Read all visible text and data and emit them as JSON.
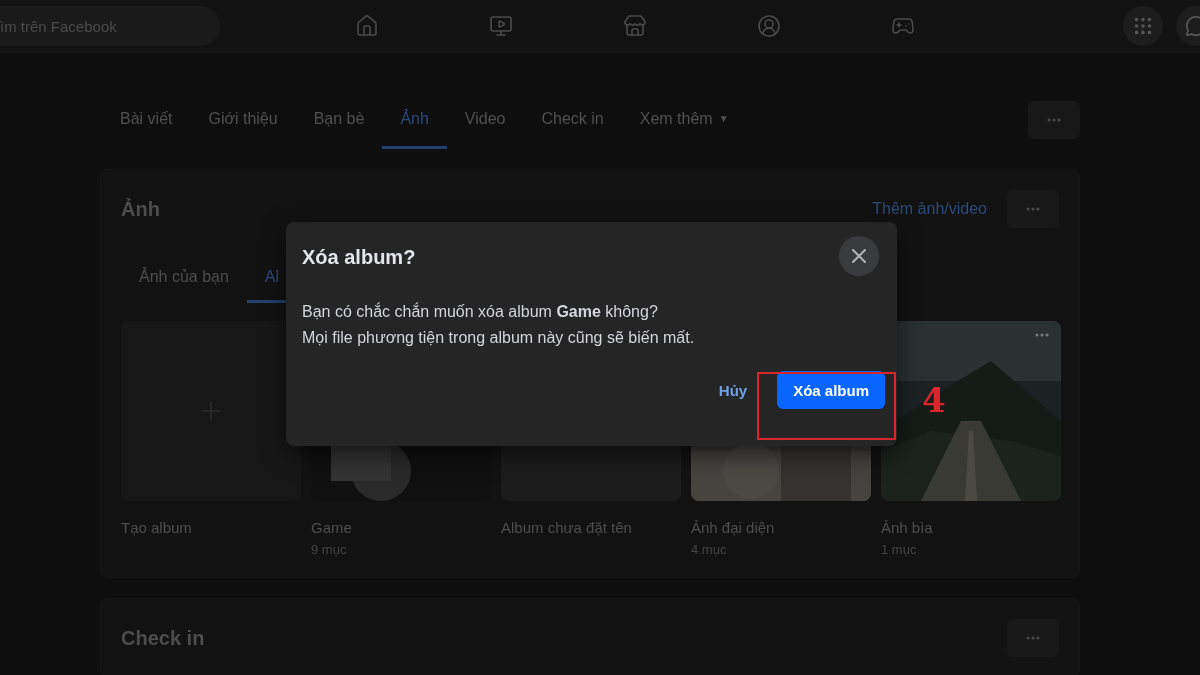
{
  "top_nav": {
    "search": {
      "placeholder": "ìm trên Facebook"
    }
  },
  "profile_tabs": [
    {
      "label": "Bài viết",
      "selected": false
    },
    {
      "label": "Giới thiệu",
      "selected": false
    },
    {
      "label": "Bạn bè",
      "selected": false
    },
    {
      "label": "Ảnh",
      "selected": true
    },
    {
      "label": "Video",
      "selected": false
    },
    {
      "label": "Check in",
      "selected": false
    },
    {
      "label": "Xem thêm",
      "selected": false,
      "caret": "▼"
    }
  ],
  "photos_section": {
    "title": "Ảnh",
    "add_link": "Thêm ảnh/video",
    "sub_tabs": [
      {
        "label": "Ảnh của bạn",
        "selected": false
      },
      {
        "label": "Al",
        "selected": true
      }
    ],
    "albums": [
      {
        "kind": "create",
        "name": "Tạo album"
      },
      {
        "name": "Game",
        "count": "9 mục"
      },
      {
        "kind": "blank",
        "name": "Album chưa đặt tên"
      },
      {
        "name": "Ảnh đại diện",
        "count": "4 mục"
      },
      {
        "name": "Ảnh bìa",
        "count": "1 mục"
      }
    ]
  },
  "checkin_section": {
    "title": "Check in"
  },
  "dialog": {
    "title": "Xóa album?",
    "message": [
      "Bạn có chắc chắn muốn xóa album **Game** không?",
      "Mọi file phương tiện trong album này cũng sẽ biến mất."
    ],
    "cancel": "Hủy",
    "confirm": "Xóa album"
  },
  "annotation": {
    "step": "4"
  }
}
